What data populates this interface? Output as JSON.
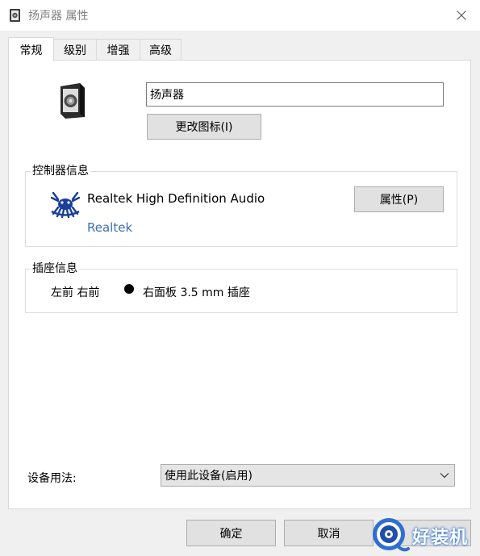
{
  "window": {
    "title": "扬声器 属性"
  },
  "tabs": [
    {
      "label": "常规",
      "active": true
    },
    {
      "label": "级别",
      "active": false
    },
    {
      "label": "增强",
      "active": false
    },
    {
      "label": "高级",
      "active": false
    }
  ],
  "general": {
    "device_name": "扬声器",
    "change_icon_label": "更改图标(I)",
    "controller": {
      "group_label": "控制器信息",
      "name": "Realtek High Definition Audio",
      "vendor": "Realtek",
      "properties_label": "属性(P)"
    },
    "jack": {
      "group_label": "插座信息",
      "position": "左前 右前",
      "description": "右面板 3.5 mm 插座"
    },
    "usage": {
      "label": "设备用法:",
      "selected": "使用此设备(启用)"
    }
  },
  "buttons": {
    "ok": "确定",
    "cancel": "取消"
  },
  "watermark": {
    "text": "好装机"
  },
  "colors": {
    "vendor_link": "#3a6fb0",
    "panel": "#ffffff",
    "dialog": "#f0f0f0"
  }
}
